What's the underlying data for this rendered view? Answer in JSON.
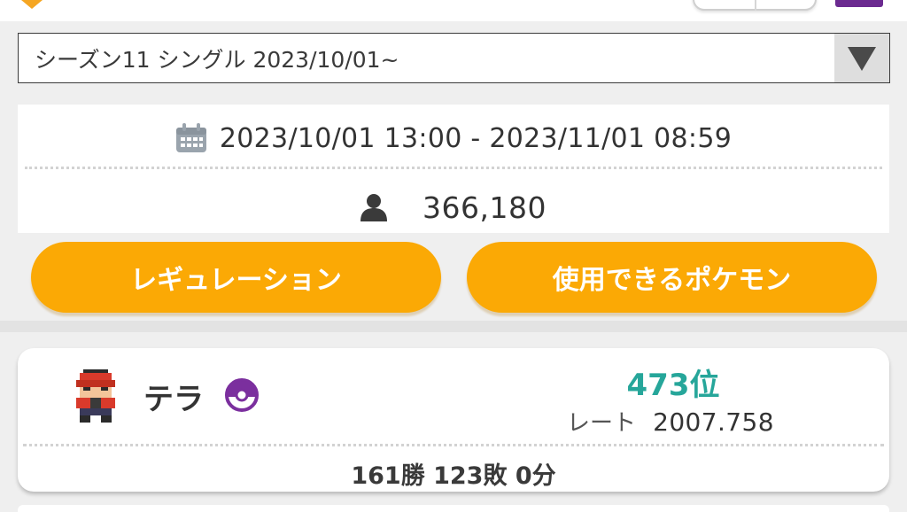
{
  "season_select": {
    "selected": "シーズン11 シングル 2023/10/01~"
  },
  "season_info": {
    "period": "2023/10/01 13:00 - 2023/11/01 08:59",
    "players": "366,180"
  },
  "buttons": {
    "regulation": "レギュレーション",
    "usable_pokemon": "使用できるポケモン"
  },
  "player_record": {
    "name": "テラ",
    "rank": "473位",
    "rate_label": "レート",
    "rate_value": "2007.758",
    "win_loss": "161勝 123敗 0分"
  },
  "colors": {
    "accent_orange": "#fba905",
    "rank_teal": "#26a69a",
    "ball_purple": "#7b2f9e"
  },
  "icons": [
    "calendar-icon",
    "person-icon",
    "dropdown-arrow-icon",
    "ball-icon",
    "trainer-avatar"
  ]
}
